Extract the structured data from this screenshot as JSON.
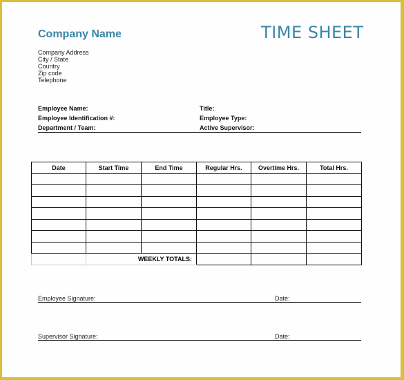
{
  "header": {
    "company_name": "Company Name",
    "title": "TIME SHEET",
    "address_lines": [
      "Company Address",
      "City / State",
      "Country",
      "Zip code",
      "Telephone"
    ]
  },
  "employee_info": {
    "left": [
      "Employee Name:",
      "Employee Identification #:",
      "Department / Team:"
    ],
    "right": [
      "Title:",
      "Employee Type:",
      "Active Supervisor:"
    ]
  },
  "table": {
    "columns": [
      "Date",
      "Start Time",
      "End Time",
      "Regular Hrs.",
      "Overtime Hrs.",
      "Total Hrs."
    ],
    "row_count": 7,
    "totals_label": "WEEKLY TOTALS:"
  },
  "signatures": {
    "employee_label": "Employee Signature:",
    "supervisor_label": "Supervisor Signature:",
    "date_label": "Date:"
  },
  "colors": {
    "accent": "#3a86a8",
    "frame": "#d9bf3a"
  }
}
